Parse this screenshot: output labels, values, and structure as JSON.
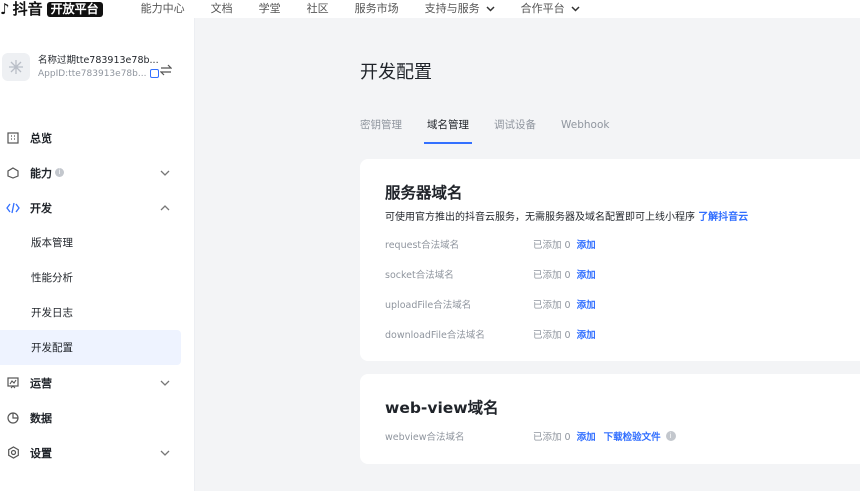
{
  "brand": {
    "logo_text": "抖音",
    "badge": "开放平台"
  },
  "topnav": [
    {
      "label": "能力中心"
    },
    {
      "label": "文档"
    },
    {
      "label": "学堂"
    },
    {
      "label": "社区"
    },
    {
      "label": "服务市场"
    },
    {
      "label": "支持与服务"
    },
    {
      "label": "合作平台"
    }
  ],
  "app": {
    "name": "名称过期tte783913e78b...",
    "appid": "AppID:tte783913e78b..."
  },
  "sidebar": {
    "overview": "总览",
    "ability": "能力",
    "develop": "开发",
    "dev_sub": [
      "版本管理",
      "性能分析",
      "开发日志",
      "开发配置"
    ],
    "operate": "运营",
    "data": "数据",
    "settings": "设置"
  },
  "page": {
    "title": "开发配置",
    "tabs": [
      "密钥管理",
      "域名管理",
      "调试设备",
      "Webhook"
    ],
    "active_tab": "域名管理"
  },
  "server_card": {
    "title": "服务器域名",
    "desc": "可使用官方推出的抖音云服务，无需服务器及域名配置即可上线小程序",
    "desc_link": "了解抖音云",
    "rows": [
      {
        "label": "request合法域名",
        "count": "已添加 0",
        "action": "添加"
      },
      {
        "label": "socket合法域名",
        "count": "已添加 0",
        "action": "添加"
      },
      {
        "label": "uploadFile合法域名",
        "count": "已添加 0",
        "action": "添加"
      },
      {
        "label": "downloadFile合法域名",
        "count": "已添加 0",
        "action": "添加"
      }
    ]
  },
  "webview_card": {
    "title": "web-view域名",
    "row": {
      "label": "webview合法域名",
      "count": "已添加 0",
      "action": "添加",
      "download": "下载检验文件"
    }
  },
  "colors": {
    "accent": "#3370ff",
    "muted": "#8f959e",
    "active_bg": "#eef3ff"
  }
}
